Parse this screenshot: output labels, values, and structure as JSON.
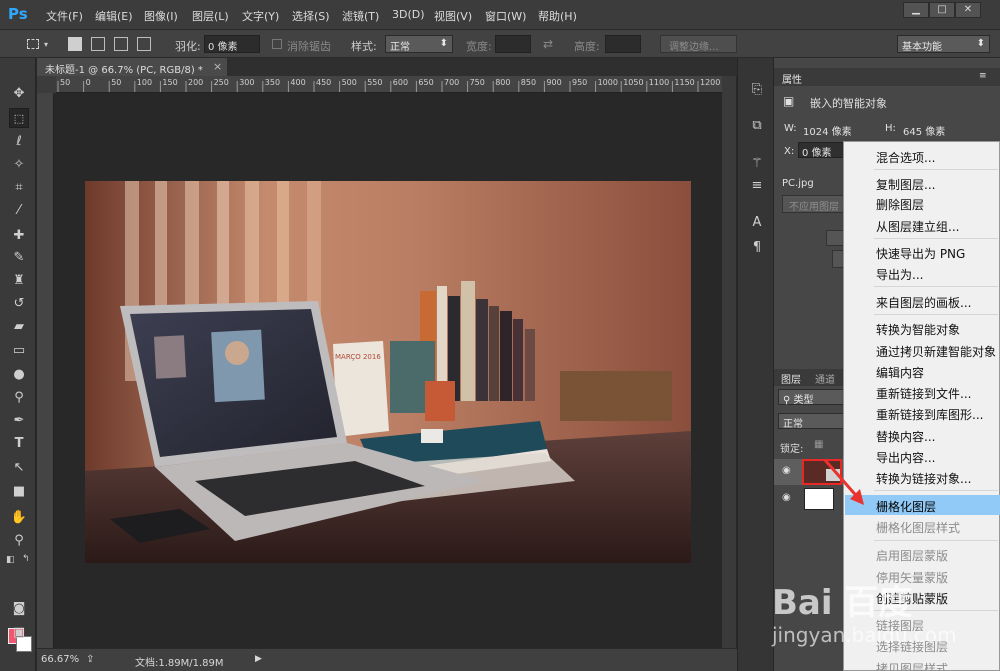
{
  "app": {
    "logo": "Ps",
    "menu": [
      "文件(F)",
      "编辑(E)",
      "图像(I)",
      "图层(L)",
      "文字(Y)",
      "选择(S)",
      "滤镜(T)",
      "3D(D)",
      "视图(V)",
      "窗口(W)",
      "帮助(H)"
    ],
    "window_buttons": {
      "minimize": "▁",
      "maximize": "□",
      "close": "✕"
    }
  },
  "options": {
    "feather_label": "羽化:",
    "feather_value": "0 像素",
    "antialias_label": "消除锯齿",
    "style_label": "样式:",
    "style_value": "正常",
    "width_label": "宽度:",
    "height_label": "高度:",
    "refine_edge": "调整边缘...",
    "workspace": "基本功能"
  },
  "document": {
    "tab_title": "未标题-1 @ 66.7% (PC, RGB/8) *",
    "tab_close": "×",
    "ruler_marks": [
      "50",
      "0",
      "50",
      "100",
      "150",
      "200",
      "250",
      "300",
      "350",
      "400",
      "450",
      "500",
      "550",
      "600",
      "650",
      "700",
      "750",
      "800",
      "850",
      "900",
      "950",
      "1000",
      "1050",
      "1100",
      "1150",
      "1200"
    ]
  },
  "status": {
    "zoom": "66.67%",
    "doc_size": "文档:1.89M/1.89M"
  },
  "properties": {
    "tab": "属性",
    "type": "嵌入的智能对象",
    "w_label": "W:",
    "w_value": "1024 像素",
    "h_label": "H:",
    "h_value": "645 像素",
    "x_label": "X:",
    "x_value": "0 像素",
    "file": "PC.jpg",
    "unapply_btn": "不应用图层"
  },
  "layers": {
    "tab_layers": "图层",
    "tab_channels": "通道",
    "filter_label": "类型",
    "blend_mode": "正常",
    "lock_label": "锁定:",
    "eye_icon": "👁"
  },
  "context_menu": {
    "items": [
      {
        "label": "混合选项...",
        "disabled": false
      },
      {
        "label": "复制图层...",
        "disabled": false
      },
      {
        "label": "删除图层",
        "disabled": false
      },
      {
        "label": "从图层建立组...",
        "disabled": false
      },
      {
        "label": "快速导出为 PNG",
        "disabled": false
      },
      {
        "label": "导出为...",
        "disabled": false
      },
      {
        "label": "来自图层的画板...",
        "disabled": false
      },
      {
        "label": "转换为智能对象",
        "disabled": false
      },
      {
        "label": "通过拷贝新建智能对象",
        "disabled": false
      },
      {
        "label": "编辑内容",
        "disabled": false
      },
      {
        "label": "重新链接到文件...",
        "disabled": false
      },
      {
        "label": "重新链接到库图形...",
        "disabled": false
      },
      {
        "label": "替换内容...",
        "disabled": false
      },
      {
        "label": "导出内容...",
        "disabled": false
      },
      {
        "label": "转换为链接对象...",
        "disabled": false
      },
      {
        "label": "栅格化图层",
        "disabled": false,
        "highlighted": true
      },
      {
        "label": "栅格化图层样式",
        "disabled": true
      },
      {
        "label": "启用图层蒙版",
        "disabled": true
      },
      {
        "label": "停用矢量蒙版",
        "disabled": true
      },
      {
        "label": "创建剪贴蒙版",
        "disabled": false
      },
      {
        "label": "链接图层",
        "disabled": true
      },
      {
        "label": "选择链接图层",
        "disabled": true
      },
      {
        "label": "拷贝图层样式",
        "disabled": true
      }
    ]
  },
  "photo": {
    "calendar_month": "MARÇO 2016"
  },
  "watermark": {
    "logo": "Bai 百度",
    "sub": "jingyan.baidu.com"
  }
}
